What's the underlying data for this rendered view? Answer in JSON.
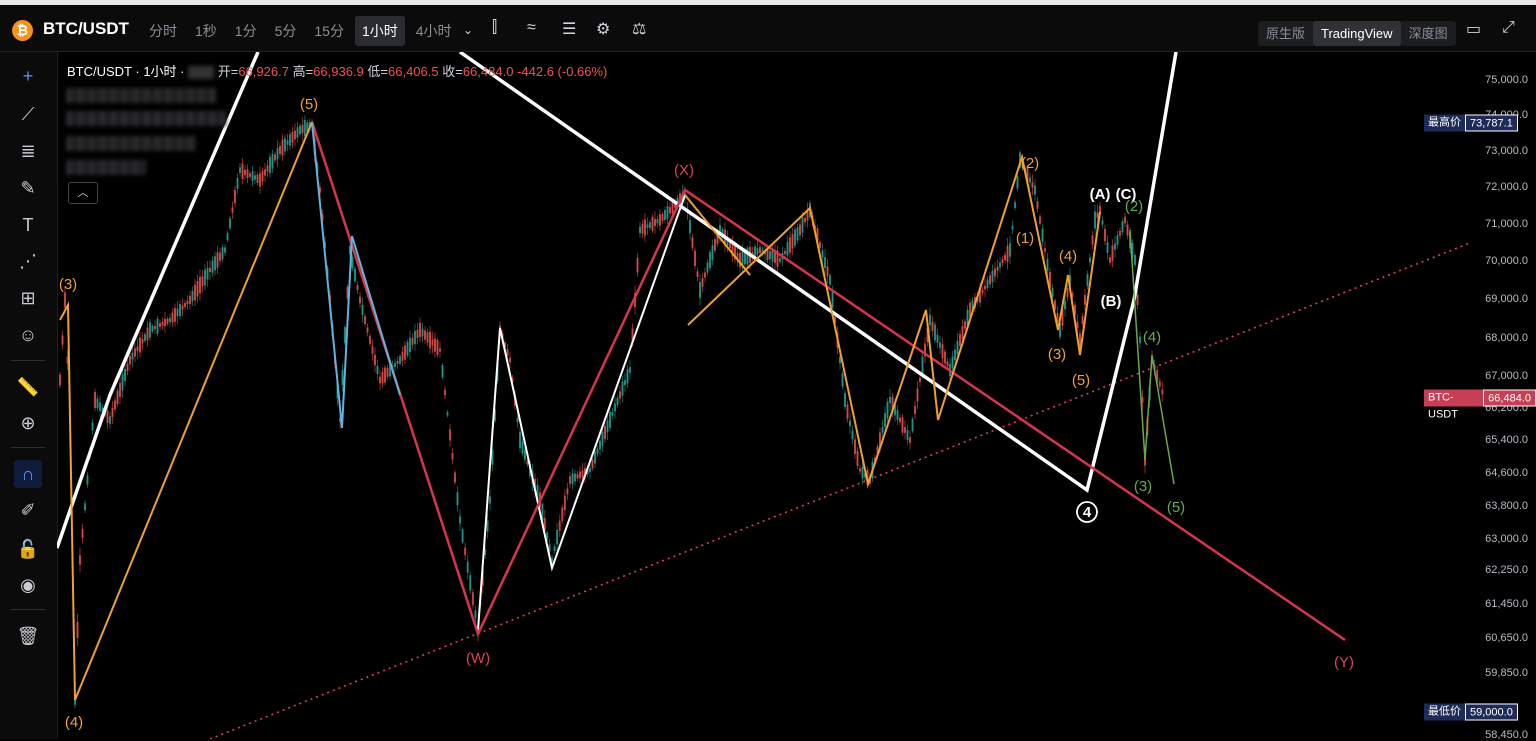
{
  "header": {
    "symbol": "BTC/USDT",
    "intervals": [
      "分时",
      "1秒",
      "1分",
      "5分",
      "15分",
      "1小时",
      "4小时"
    ],
    "active_interval": "1小时",
    "views": [
      "原生版",
      "TradingView",
      "深度图"
    ],
    "active_view": "TradingView"
  },
  "legend": {
    "title": "BTC/USDT · 1小时 ·",
    "open_label": "开=",
    "open": "66,926.7",
    "high_label": "高=",
    "high": "66,936.9",
    "low_label": "低=",
    "low": "66,406.5",
    "close_label": "收=",
    "close": "66,484.0",
    "change": "-442.6 (-0.66%)"
  },
  "chart_data": {
    "type": "line",
    "title": "",
    "xlabel": "",
    "ylabel": "",
    "y_ticks": [
      "75,000.0",
      "74,000.0",
      "73,000.0",
      "72,000.0",
      "71,000.0",
      "70,000.0",
      "69,000.0",
      "68,000.0",
      "67,000.0",
      "66,200.0",
      "65,400.0",
      "64,600.0",
      "63,800.0",
      "63,000.0",
      "62,250.0",
      "61,450.0",
      "60,650.0",
      "59,850.0",
      "58,450.0"
    ],
    "price_tags": [
      {
        "label": "最高价",
        "value": "73,787.1",
        "color": "#1e2a57"
      },
      {
        "label": "BTC-USDT",
        "value": "66,484.0",
        "color": "#c73e55"
      },
      {
        "label": "最低价",
        "value": "59,000.0",
        "color": "#1e2a57"
      }
    ],
    "wave_labels": [
      {
        "text": "(5)",
        "color": "#f0a030"
      },
      {
        "text": "(3)",
        "color": "#f0a030"
      },
      {
        "text": "(4)",
        "color": "#f0a030"
      },
      {
        "text": "(X)",
        "color": "#e0405a"
      },
      {
        "text": "(W)",
        "color": "#e0405a"
      },
      {
        "text": "(Y)",
        "color": "#e0405a"
      },
      {
        "text": "(2)",
        "color": "#f0a030"
      },
      {
        "text": "(1)",
        "color": "#f0a030"
      },
      {
        "text": "(4)",
        "color": "#f0a030"
      },
      {
        "text": "(3)",
        "color": "#f0a030"
      },
      {
        "text": "(5)",
        "color": "#f0a030"
      },
      {
        "text": "(A)",
        "color": "#ffffff"
      },
      {
        "text": "(C)",
        "color": "#ffffff"
      },
      {
        "text": "(B)",
        "color": "#ffffff"
      },
      {
        "text": "(2)",
        "color": "#6aa84f"
      },
      {
        "text": "(4)",
        "color": "#6aa84f"
      },
      {
        "text": "(3)",
        "color": "#6aa84f"
      },
      {
        "text": "(5)",
        "color": "#6aa84f"
      },
      {
        "text": "4",
        "color": "#ffffff"
      }
    ]
  }
}
